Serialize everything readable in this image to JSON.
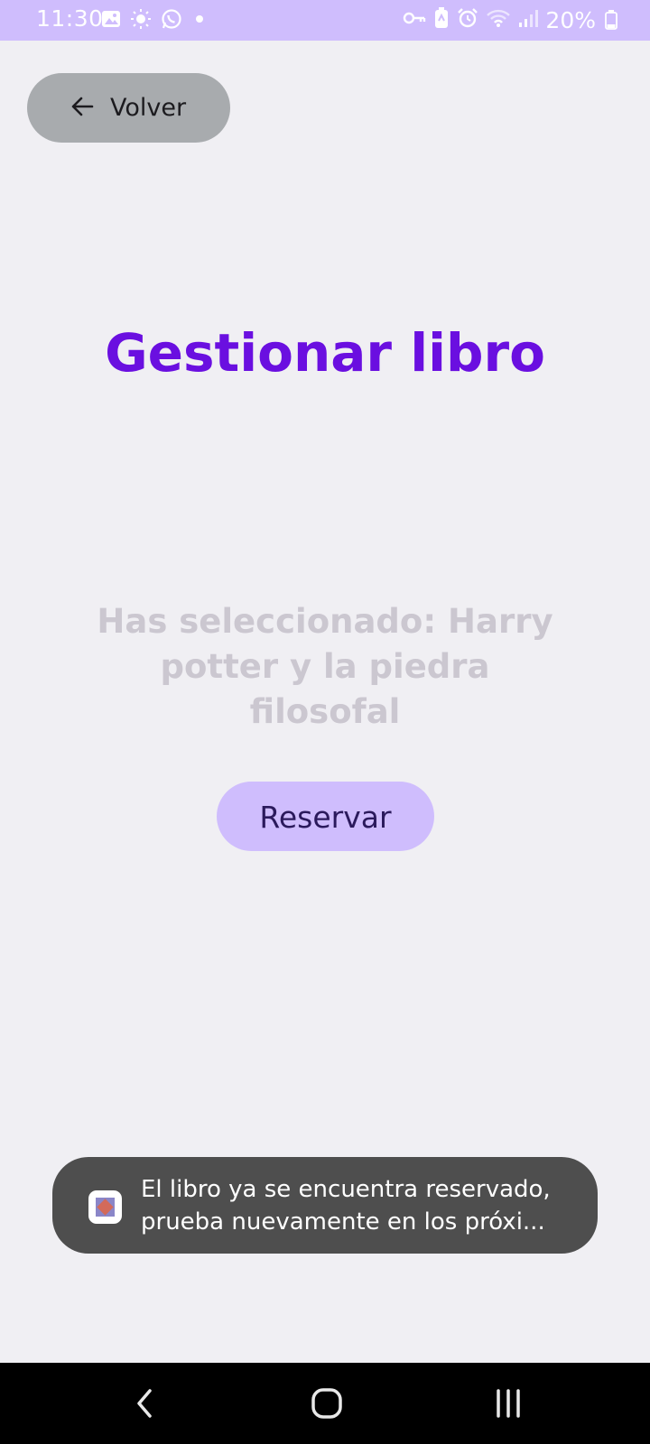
{
  "status_bar": {
    "time": "11:30",
    "battery_text": "20%",
    "left_icons": [
      "image-icon",
      "brightness-icon",
      "whatsapp-icon",
      "dot-icon"
    ],
    "right_icons": [
      "key-icon",
      "battery-saver-icon",
      "alarm-icon",
      "wifi-icon",
      "signal-icon",
      "battery-icon"
    ],
    "background_color": "#cfbdfd"
  },
  "header": {
    "back_label": "Volver",
    "back_icon": "arrow-left-icon"
  },
  "main": {
    "title": "Gestionar libro",
    "title_color": "#6a0fe0",
    "selected_text": "Has seleccionado: Harry potter y la piedra filosofal",
    "reserve_label": "Reservar"
  },
  "toast": {
    "line1": "El libro ya se encuentra reservado,",
    "line2": "prueba nuevamente en los próxi...",
    "app_icon": "app-icon"
  },
  "navigation": {
    "items": [
      "back-nav-icon",
      "home-nav-icon",
      "recents-nav-icon"
    ]
  }
}
